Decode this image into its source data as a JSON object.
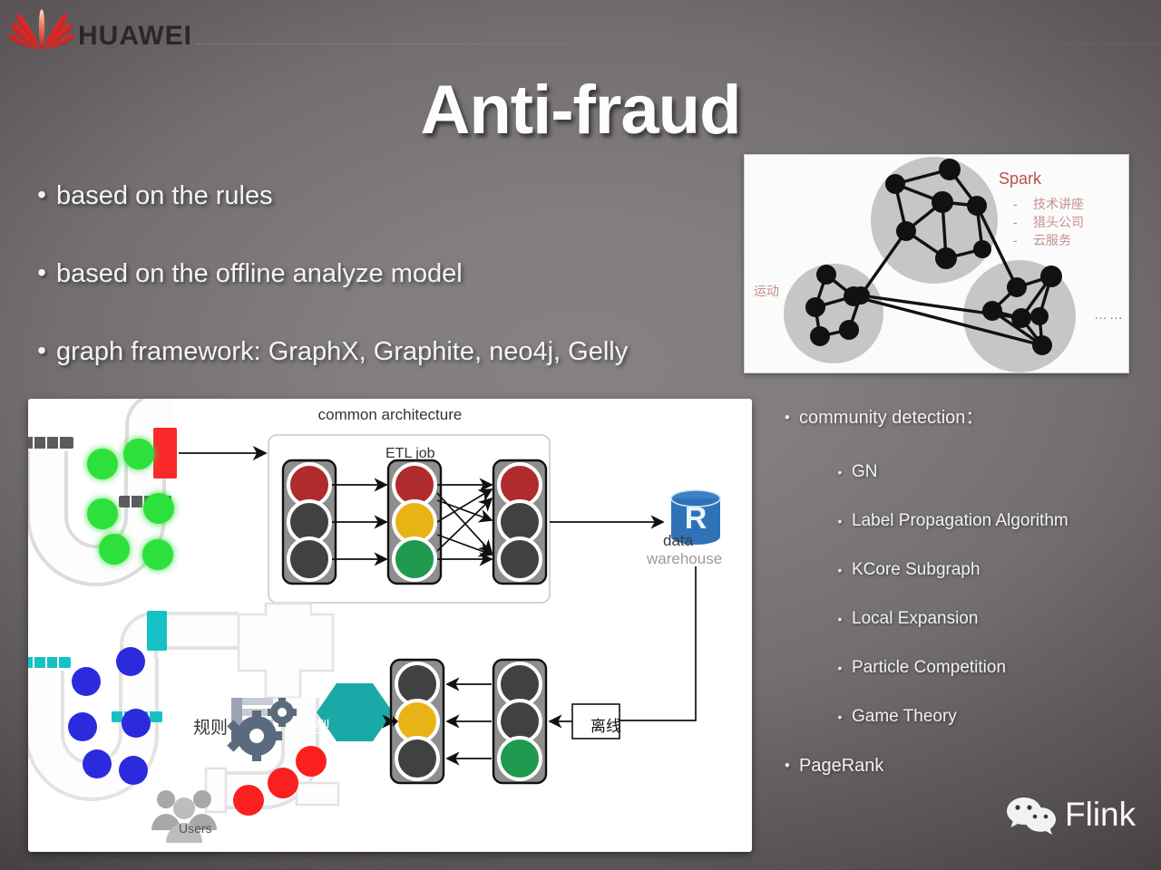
{
  "brand": {
    "name": "HUAWEI",
    "logo_icon": "huawei-flower-logo"
  },
  "title": "Anti-fraud",
  "left_bullets": [
    "based on the rules",
    "based on the offline analyze model",
    "graph framework: GraphX, Graphite, neo4j, Gelly"
  ],
  "graph_image": {
    "heading": "Spark",
    "items": [
      "技术讲座",
      "猎头公司",
      "云服务"
    ],
    "dash": "-",
    "side_label": "运动",
    "ellipsis": "……",
    "heading_color": "#b4524b",
    "item_color": "#c98e8e",
    "cluster_color": "#c6c6c6",
    "node_color": "#111111"
  },
  "right_bullets": {
    "level1_first": "community detection：",
    "level2": [
      "GN",
      "Label Propagation Algorithm",
      "KCore Subgraph",
      "Local Expansion",
      "Particle Competition",
      "Game Theory"
    ],
    "level1_last": "PageRank"
  },
  "flink": {
    "label": "Flink",
    "icon": "wechat-icon"
  },
  "architecture": {
    "title": "common architecture",
    "etl_label": "ETL job",
    "warehouse_line1": "data",
    "warehouse_line2": "warehouse",
    "warehouse_letter": "R",
    "rules_label": "规则",
    "model_label": "模型",
    "offline_label": "离线",
    "users_label": "Users",
    "colors": {
      "red": "#b02b2b",
      "yellow": "#e8b415",
      "green": "#1f9a4e",
      "dark": "#414141",
      "light_ball": "#2ee03a",
      "blue_ball": "#2b2bdd",
      "red_ball": "#fa2020",
      "teal": "#1aa9a6",
      "db_blue": "#2f72b8"
    },
    "top_lights": [
      {
        "name": "ingest-light",
        "lamps": [
          "red",
          "dark",
          "dark"
        ]
      },
      {
        "name": "etl-light",
        "lamps": [
          "red",
          "yellow",
          "green"
        ]
      },
      {
        "name": "output-light",
        "lamps": [
          "red",
          "dark",
          "dark"
        ]
      }
    ],
    "bottom_lights": [
      {
        "name": "serving-light",
        "lamps": [
          "dark",
          "yellow",
          "dark"
        ]
      },
      {
        "name": "offline-light",
        "lamps": [
          "dark",
          "dark",
          "green"
        ]
      }
    ]
  }
}
